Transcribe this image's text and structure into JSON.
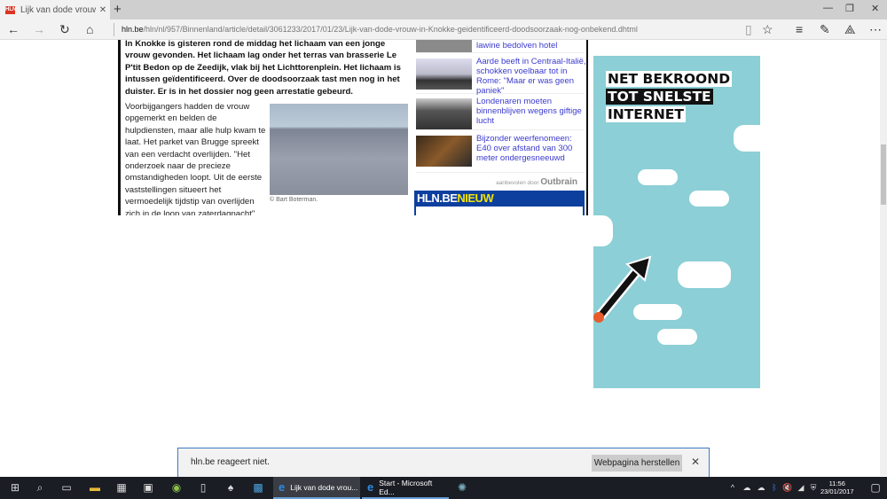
{
  "browser": {
    "tab_title": "Lijk van dode vrouw in k",
    "favicon": "HLN",
    "url_domain": "hln.be",
    "url_path": "/hln/nl/957/Binnenland/article/detail/3061233/2017/01/23/Lijk-van-dode-vrouw-in-Knokke-geidentificeerd-doodsoorzaak-nog-onbekend.dhtml"
  },
  "article": {
    "lead": "In Knokke is gisteren rond de middag het lichaam van een jonge vrouw gevonden. Het lichaam lag onder het terras van brasserie Le P'tit Bedon op de Zeedijk, vlak bij het Lichttorenplein. Het lichaam is intussen geïdentificeerd. Over de doodsoorzaak tast men nog in het duister. Er is in het dossier nog geen arrestatie gebeurd.",
    "body": "Voorbijgangers hadden de vrouw opgemerkt en belden de hulpdiensten, maar alle hulp kwam te laat. Het parket van Brugge spreekt van een verdacht overlijden. \"Het onderzoek naar de precieze omstandigheden loopt. Uit de eerste vaststellingen situeert het vermoedelijk tijdstip van overlijden zich in de loop van zaterdagnacht\",",
    "photo_credit": "© Bart Boterman."
  },
  "sidebar": {
    "items": [
      {
        "title": "lawine bedolven hotel"
      },
      {
        "title": "Aarde beeft in Centraal-Italië, schokken voelbaar tot in Rome: \"Maar er was geen paniek\""
      },
      {
        "title": "Londenaren moeten binnenblijven wegens giftige lucht"
      },
      {
        "title": "Bijzonder weerfenomeen: E40 over afstand van 300 meter ondergesneeuwd"
      }
    ],
    "recommended_by": "aanbevolen door",
    "outbrain": "Outbrain",
    "hln_label": "HLN.BE",
    "hln_nieuw": "NIEUW"
  },
  "ad": {
    "lines": [
      "NET BEKROOND",
      "TOT SNELSTE",
      "INTERNET"
    ]
  },
  "notification": {
    "message": "hln.be reageert niet.",
    "button": "Webpagina herstellen"
  },
  "taskbar": {
    "apps": [
      "Lijk van dode vrou...",
      "Start - Microsoft Ed..."
    ],
    "time": "11:56",
    "date": "23/01/2017"
  }
}
